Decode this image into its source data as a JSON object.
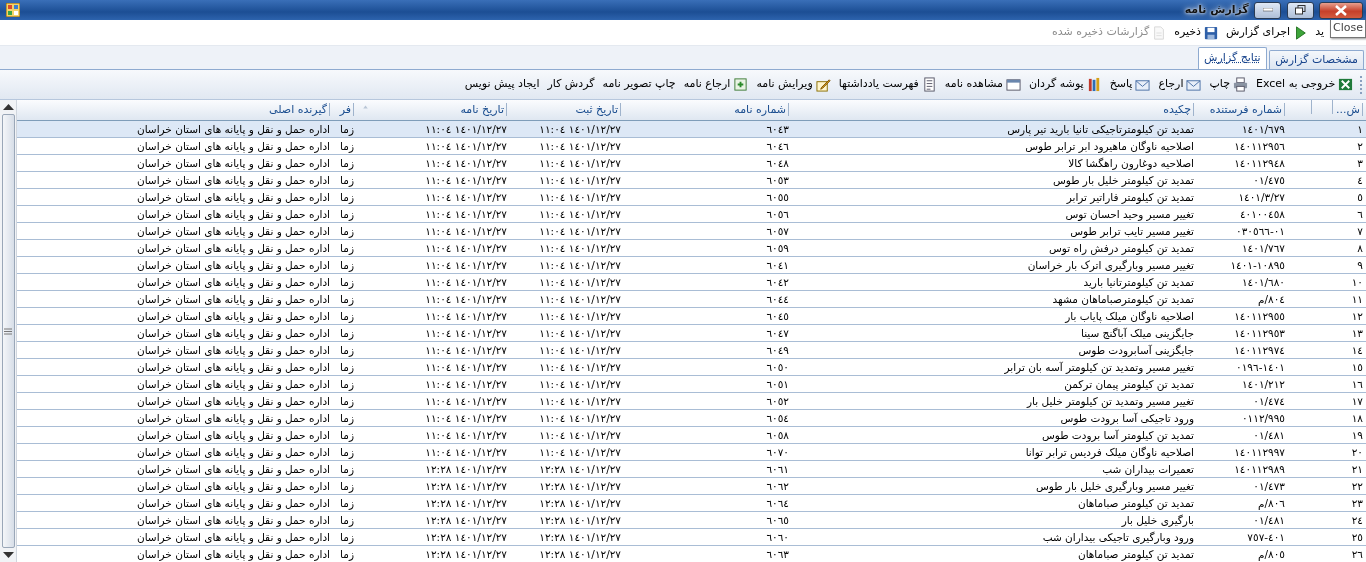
{
  "window": {
    "title": "گزارش نامه"
  },
  "toolbar": {
    "items": [
      {
        "kind": "text",
        "label": "ید",
        "disabled": false
      },
      {
        "kind": "run",
        "label": "اجرای گزارش",
        "disabled": false
      },
      {
        "kind": "save",
        "label": "ذخیره",
        "disabled": false
      },
      {
        "kind": "saved",
        "label": "گزارشات ذخیره شده",
        "disabled": true
      }
    ],
    "tooltip": "Close"
  },
  "tabs": [
    {
      "label": "مشخصات گزارش",
      "selected": false
    },
    {
      "label": "نتایج گزارش",
      "selected": true
    }
  ],
  "actions": [
    {
      "kind": "excel",
      "label": "خروجی به Excel"
    },
    {
      "kind": "print",
      "label": "چاپ"
    },
    {
      "kind": "mail",
      "label": "ارجاع"
    },
    {
      "kind": "mail",
      "label": "پاسخ"
    },
    {
      "kind": "books",
      "label": "پوشه گردان"
    },
    {
      "kind": "view",
      "label": "مشاهده نامه"
    },
    {
      "kind": "list",
      "label": "فهرست یادداشتها"
    },
    {
      "kind": "edit",
      "label": "ویرایش نامه"
    },
    {
      "kind": "refer",
      "label": "ارجاع نامه"
    },
    {
      "kind": "text",
      "label": "چاپ تصویر نامه"
    },
    {
      "kind": "text",
      "label": "گردش کار"
    },
    {
      "kind": "text",
      "label": "ایجاد پیش نویس"
    }
  ],
  "table": {
    "columns": [
      {
        "kind": "text",
        "label": "ش..."
      },
      {
        "kind": "blank"
      },
      {
        "kind": "blank"
      },
      {
        "kind": "text",
        "label": "شماره فرستنده"
      },
      {
        "kind": "text",
        "label": "چکیده"
      },
      {
        "kind": "text",
        "label": "شماره نامه"
      },
      {
        "kind": "text",
        "label": "تاریخ ثبت"
      },
      {
        "kind": "text",
        "label": "تاریخ نامه",
        "sorted": true
      },
      {
        "kind": "text",
        "label": "فر"
      },
      {
        "kind": "text",
        "label": "گیرنده اصلی"
      }
    ],
    "rows": [
      {
        "selected": true,
        "cells": [
          "١",
          "",
          "",
          "١٤٠١/٦٧٩",
          "تمدید تن کیلومترتاجیکی تانیا بارید تیر پارس",
          "٦٠٤٣",
          "١٤٠١/١٢/٢٧ ١١:٠٤",
          "١٤٠١/١٢/٢٧ ١١:٠٤",
          "زما",
          "اداره حمل و نقل و پایانه های استان خراسان"
        ]
      },
      {
        "selected": false,
        "cells": [
          "٢",
          "",
          "",
          "١٤٠١١٢٩٥٦",
          "اصلاحیه ناوگان ماهیرود ابر ترابر طوس",
          "٦٠٤٦",
          "١٤٠١/١٢/٢٧ ١١:٠٤",
          "١٤٠١/١٢/٢٧ ١١:٠٤",
          "زما",
          "اداره حمل و نقل و پایانه های استان خراسان"
        ]
      },
      {
        "selected": false,
        "cells": [
          "٣",
          "",
          "",
          "١٤٠١١٢٩٤٨",
          "اصلاحیه دوغارون راهگشا کالا",
          "٦٠٤٨",
          "١٤٠١/١٢/٢٧ ١١:٠٤",
          "١٤٠١/١٢/٢٧ ١١:٠٤",
          "زما",
          "اداره حمل و نقل و پایانه های استان خراسان"
        ]
      },
      {
        "selected": false,
        "cells": [
          "٤",
          "",
          "",
          "٠١/٤٧٥",
          "تمدید تن کیلومتر خلیل بار طوس",
          "٦٠٥٣",
          "١٤٠١/١٢/٢٧ ١١:٠٤",
          "١٤٠١/١٢/٢٧ ١١:٠٤",
          "زما",
          "اداره حمل و نقل و پایانه های استان خراسان"
        ]
      },
      {
        "selected": false,
        "cells": [
          "٥",
          "",
          "",
          "١٤٠١/٣/٢٧",
          "تمدید تن کیلومتر فاراتیر ترابر",
          "٦٠٥٥",
          "١٤٠١/١٢/٢٧ ١١:٠٤",
          "١٤٠١/١٢/٢٧ ١١:٠٤",
          "زما",
          "اداره حمل و نقل و پایانه های استان خراسان"
        ]
      },
      {
        "selected": false,
        "cells": [
          "٦",
          "",
          "",
          "٤٠١٠٠٤٥٨",
          "تغییر مسیر وحید احسان توس",
          "٦٠٥٦",
          "١٤٠١/١٢/٢٧ ١١:٠٤",
          "١٤٠١/١٢/٢٧ ١١:٠٤",
          "زما",
          "اداره حمل و نقل و پایانه های استان خراسان"
        ]
      },
      {
        "selected": false,
        "cells": [
          "٧",
          "",
          "",
          "٠١-٠٣٠٥٦٦",
          "تغییر مسیر تایب ترابر طوس",
          "٦٠٥٧",
          "١٤٠١/١٢/٢٧ ١١:٠٤",
          "١٤٠١/١٢/٢٧ ١١:٠٤",
          "زما",
          "اداره حمل و نقل و پایانه های استان خراسان"
        ]
      },
      {
        "selected": false,
        "cells": [
          "٨",
          "",
          "",
          "١٤٠١/٧٦٧",
          "تمدید تن کیلومتر درفش راه توس",
          "٦٠٥٩",
          "١٤٠١/١٢/٢٧ ١١:٠٤",
          "١٤٠١/١٢/٢٧ ١١:٠٤",
          "زما",
          "اداره حمل و نقل و پایانه های استان خراسان"
        ]
      },
      {
        "selected": false,
        "cells": [
          "٩",
          "",
          "",
          "١٠٨٩٥-١٤٠١",
          "تغییر مسیر وبارگیری اترک بار خراسان",
          "٦٠٤١",
          "١٤٠١/١٢/٢٧ ١١:٠٤",
          "١٤٠١/١٢/٢٧ ١١:٠٤",
          "زما",
          "اداره حمل و نقل و پایانه های استان خراسان"
        ]
      },
      {
        "selected": false,
        "cells": [
          "١٠",
          "",
          "",
          "١٤٠١/٦٨٠",
          "تمدید تن کیلومترتانیا بارید",
          "٦٠٤٢",
          "١٤٠١/١٢/٢٧ ١١:٠٤",
          "١٤٠١/١٢/٢٧ ١١:٠٤",
          "زما",
          "اداره حمل و نقل و پایانه های استان خراسان"
        ]
      },
      {
        "selected": false,
        "cells": [
          "١١",
          "",
          "",
          "٨٠٤/م",
          "تمدید تن کیلومترصباماهان مشهد",
          "٦٠٤٤",
          "١٤٠١/١٢/٢٧ ١١:٠٤",
          "١٤٠١/١٢/٢٧ ١١:٠٤",
          "زما",
          "اداره حمل و نقل و پایانه های استان خراسان"
        ]
      },
      {
        "selected": false,
        "cells": [
          "١٢",
          "",
          "",
          "١٤٠١١٢٩٥٥",
          "اصلاحیه ناوگان میلک پایاب بار",
          "٦٠٤٥",
          "١٤٠١/١٢/٢٧ ١١:٠٤",
          "١٤٠١/١٢/٢٧ ١١:٠٤",
          "زما",
          "اداره حمل و نقل و پایانه های استان خراسان"
        ]
      },
      {
        "selected": false,
        "cells": [
          "١٣",
          "",
          "",
          "١٤٠١١٢٩٥٣",
          "جایگزینی میلک آباگنج سینا",
          "٦٠٤٧",
          "١٤٠١/١٢/٢٧ ١١:٠٤",
          "١٤٠١/١٢/٢٧ ١١:٠٤",
          "زما",
          "اداره حمل و نقل و پایانه های استان خراسان"
        ]
      },
      {
        "selected": false,
        "cells": [
          "١٤",
          "",
          "",
          "١٤٠١١٢٩٧٤",
          "جایگزینی آسابرودت طوس",
          "٦٠٤٩",
          "١٤٠١/١٢/٢٧ ١١:٠٤",
          "١٤٠١/١٢/٢٧ ١١:٠٤",
          "زما",
          "اداره حمل و نقل و پایانه های استان خراسان"
        ]
      },
      {
        "selected": false,
        "cells": [
          "١٥",
          "",
          "",
          "١٤٠١-٠١٩٦",
          "تغییر مسیر وتمدید تن کیلومتر آسه بان ترابر",
          "٦٠٥٠",
          "١٤٠١/١٢/٢٧ ١١:٠٤",
          "١٤٠١/١٢/٢٧ ١١:٠٤",
          "زما",
          "اداره حمل و نقل و پایانه های استان خراسان"
        ]
      },
      {
        "selected": false,
        "cells": [
          "١٦",
          "",
          "",
          "١٤٠١/٢١٢",
          "تمدید تن کیلومتر پیمان ترکمن",
          "٦٠٥١",
          "١٤٠١/١٢/٢٧ ١١:٠٤",
          "١٤٠١/١٢/٢٧ ١١:٠٤",
          "زما",
          "اداره حمل و نقل و پایانه های استان خراسان"
        ]
      },
      {
        "selected": false,
        "cells": [
          "١٧",
          "",
          "",
          "٠١/٤٧٤",
          "تغییر مسیر وتمدید تن کیلومتر خلیل بار",
          "٦٠٥٢",
          "١٤٠١/١٢/٢٧ ١١:٠٤",
          "١٤٠١/١٢/٢٧ ١١:٠٤",
          "زما",
          "اداره حمل و نقل و پایانه های استان خراسان"
        ]
      },
      {
        "selected": false,
        "cells": [
          "١٨",
          "",
          "",
          "٠١١٢/٩٩٥",
          "ورود تاجیکی آسا برودت طوس",
          "٦٠٥٤",
          "١٤٠١/١٢/٢٧ ١١:٠٤",
          "١٤٠١/١٢/٢٧ ١١:٠٤",
          "زما",
          "اداره حمل و نقل و پایانه های استان خراسان"
        ]
      },
      {
        "selected": false,
        "cells": [
          "١٩",
          "",
          "",
          "٠١/٤٨١",
          "تمدید تن کیلومتر آسا برودت طوس",
          "٦٠٥٨",
          "١٤٠١/١٢/٢٧ ١١:٠٤",
          "١٤٠١/١٢/٢٧ ١١:٠٤",
          "زما",
          "اداره حمل و نقل و پایانه های استان خراسان"
        ]
      },
      {
        "selected": false,
        "cells": [
          "٢٠",
          "",
          "",
          "١٤٠١١٢٩٩٧",
          "اصلاحیه ناوگان میلک فردیس ترابر توانا",
          "٦٠٧٠",
          "١٤٠١/١٢/٢٧ ١١:٠٤",
          "١٤٠١/١٢/٢٧ ١١:٠٤",
          "زما",
          "اداره حمل و نقل و پایانه های استان خراسان"
        ]
      },
      {
        "selected": false,
        "cells": [
          "٢١",
          "",
          "",
          "١٤٠١١٢٩٨٩",
          "تعمیرات بیداران شب",
          "٦٠٦١",
          "١٤٠١/١٢/٢٧ ١٢:٢٨",
          "١٤٠١/١٢/٢٧ ١٢:٢٨",
          "زما",
          "اداره حمل و نقل و پایانه های استان خراسان"
        ]
      },
      {
        "selected": false,
        "cells": [
          "٢٢",
          "",
          "",
          "٠١/٤٧٣",
          "تغییر مسیر وبارگیری خلیل بار طوس",
          "٦٠٦٢",
          "١٤٠١/١٢/٢٧ ١٢:٢٨",
          "١٤٠١/١٢/٢٧ ١٢:٢٨",
          "زما",
          "اداره حمل و نقل و پایانه های استان خراسان"
        ]
      },
      {
        "selected": false,
        "cells": [
          "٢٣",
          "",
          "",
          "٨٠٦/م",
          "تمدید تن کیلومتر صباماهان",
          "٦٠٦٤",
          "١٤٠١/١٢/٢٧ ١٢:٢٨",
          "١٤٠١/١٢/٢٧ ١٢:٢٨",
          "زما",
          "اداره حمل و نقل و پایانه های استان خراسان"
        ]
      },
      {
        "selected": false,
        "cells": [
          "٢٤",
          "",
          "",
          "٠١/٤٨١",
          "بارگیری خلیل بار",
          "٦٠٦٥",
          "١٤٠١/١٢/٢٧ ١٢:٢٨",
          "١٤٠١/١٢/٢٧ ١٢:٢٨",
          "زما",
          "اداره حمل و نقل و پایانه های استان خراسان"
        ]
      },
      {
        "selected": false,
        "cells": [
          "٢٥",
          "",
          "",
          "٤٠١-٧٥٧",
          "ورود وبارگیری تاجیکی بیداران شب",
          "٦٠٦٠",
          "١٤٠١/١٢/٢٧ ١٢:٢٨",
          "١٤٠١/١٢/٢٧ ١٢:٢٨",
          "زما",
          "اداره حمل و نقل و پایانه های استان خراسان"
        ]
      },
      {
        "selected": false,
        "cells": [
          "٢٦",
          "",
          "",
          "٨٠٥/م",
          "تمدید تن کیلومتر صباماهان",
          "٦٠٦٣",
          "١٤٠١/١٢/٢٧ ١٢:٢٨",
          "١٤٠١/١٢/٢٧ ١٢:٢٨",
          "زما",
          "اداره حمل و نقل و پایانه های استان خراسان"
        ]
      }
    ]
  }
}
